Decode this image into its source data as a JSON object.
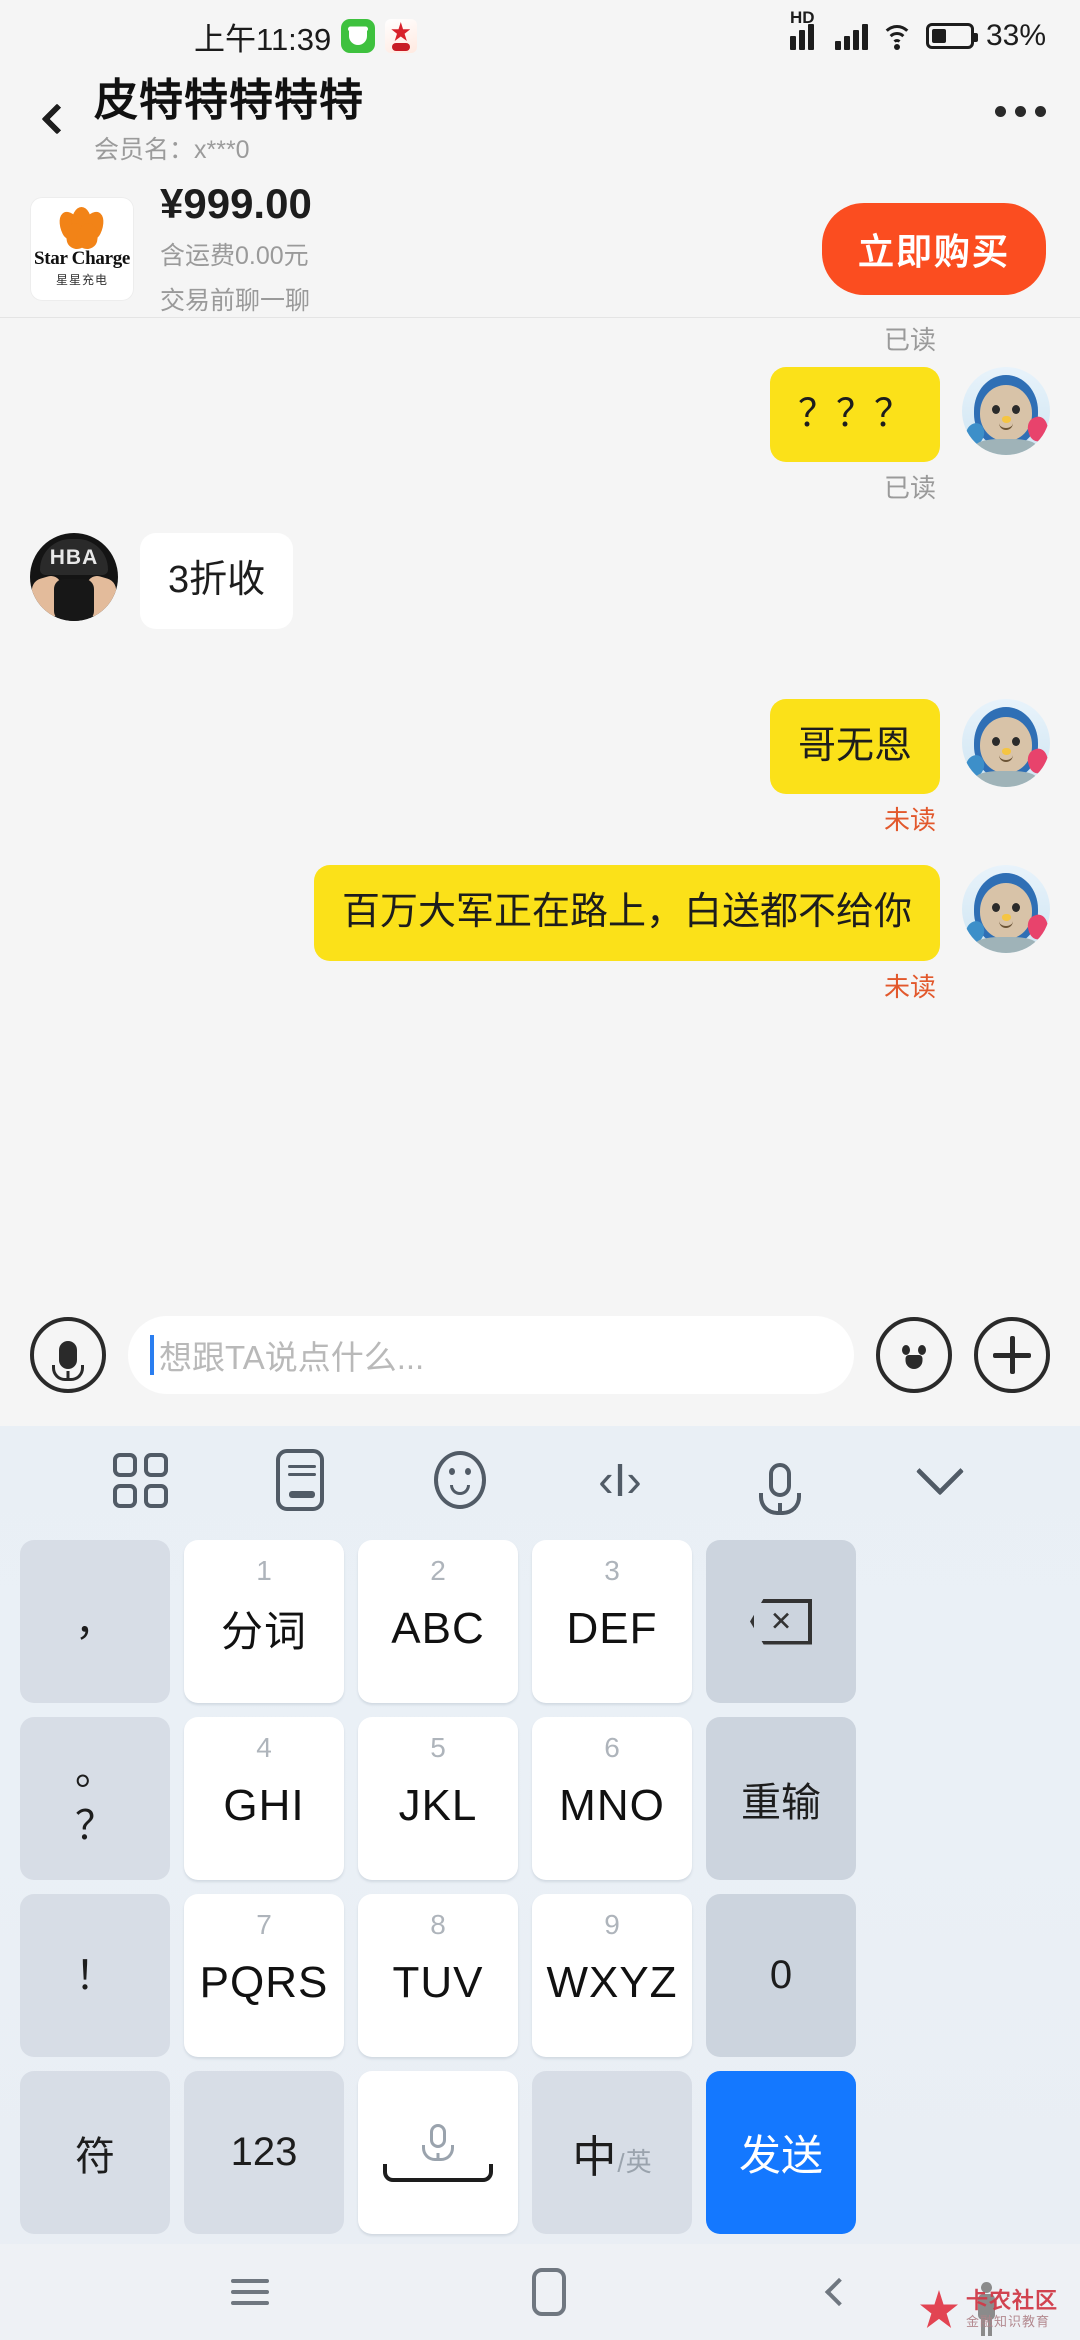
{
  "status_bar": {
    "time": "上午11:39",
    "battery_percent": "33%",
    "hd_label": "HD",
    "icons": [
      "android-app-icon",
      "red-app-icon",
      "signal-bars-icon",
      "signal-bars-icon",
      "wifi-icon",
      "battery-icon"
    ]
  },
  "header": {
    "title": "皮特特特特特",
    "subtitle": "会员名：x***0",
    "back_icon": "chevron-left-icon",
    "more_icon": "more-horizontal-icon"
  },
  "product": {
    "brand_name": "Star Charge",
    "brand_cn": "星星充电",
    "price": "¥999.00",
    "shipping": "含运费0.00元",
    "chat_note": "交易前聊一聊",
    "buy_label": "立即购买",
    "buy_color": "#fb4d20"
  },
  "chat": {
    "messages": [
      {
        "side": "out",
        "text": "？？？",
        "status": "已读",
        "status_type": "read",
        "avatar": "seal-avatar",
        "bubble": "yellow"
      },
      {
        "side": "in",
        "text": "3折收",
        "status": "",
        "status_type": "none",
        "avatar": "hba-avatar",
        "bubble": "white"
      },
      {
        "side": "out",
        "text": "哥无恩",
        "status": "未读",
        "status_type": "unread",
        "avatar": "seal-avatar",
        "bubble": "yellow"
      },
      {
        "side": "out",
        "text": "百万大军正在路上，白送都不给你",
        "status": "未读",
        "status_type": "unread",
        "avatar": "seal-avatar",
        "bubble": "yellow"
      }
    ],
    "partial_top_status": "已读",
    "read_color": "#9a9a9a",
    "unread_color": "#e2582c",
    "bubble_yellow": "#fbe119"
  },
  "input_bar": {
    "placeholder": "想跟TA说点什么...",
    "voice_icon": "microphone-icon",
    "emoji_icon": "smiley-icon",
    "add_icon": "plus-icon"
  },
  "keyboard": {
    "toolbar": [
      {
        "icon": "grid-apps-icon"
      },
      {
        "icon": "keyboard-switch-icon"
      },
      {
        "icon": "emoji-icon"
      },
      {
        "icon": "text-cursor-icon"
      },
      {
        "icon": "microphone-icon"
      },
      {
        "icon": "chevron-down-icon"
      }
    ],
    "rows": [
      {
        "punct": [
          "，"
        ],
        "keys": [
          {
            "num": "1",
            "label": "分词"
          },
          {
            "num": "2",
            "label": "ABC"
          },
          {
            "num": "3",
            "label": "DEF"
          }
        ],
        "func": {
          "icon": "backspace-icon",
          "label": ""
        }
      },
      {
        "punct": [
          "。",
          "？"
        ],
        "keys": [
          {
            "num": "4",
            "label": "GHI"
          },
          {
            "num": "5",
            "label": "JKL"
          },
          {
            "num": "6",
            "label": "MNO"
          }
        ],
        "func": {
          "icon": "",
          "label": "重输"
        }
      },
      {
        "punct": [
          "！"
        ],
        "keys": [
          {
            "num": "7",
            "label": "PQRS"
          },
          {
            "num": "8",
            "label": "TUV"
          },
          {
            "num": "9",
            "label": "WXYZ"
          }
        ],
        "func": {
          "icon": "",
          "label": "0"
        }
      }
    ],
    "bottom_row": {
      "symbol": "符",
      "numeric": "123",
      "space_icon": "microphone-space-icon",
      "lang_cn": "中",
      "lang_sep": "/",
      "lang_en": "英",
      "send": "发送",
      "send_color": "#1478ff"
    }
  },
  "nav_bar": {
    "recent_icon": "recent-apps-icon",
    "home_icon": "home-icon",
    "back_icon": "back-icon"
  },
  "watermark": {
    "line1": "卡农社区",
    "line2": "金融知识教育"
  }
}
